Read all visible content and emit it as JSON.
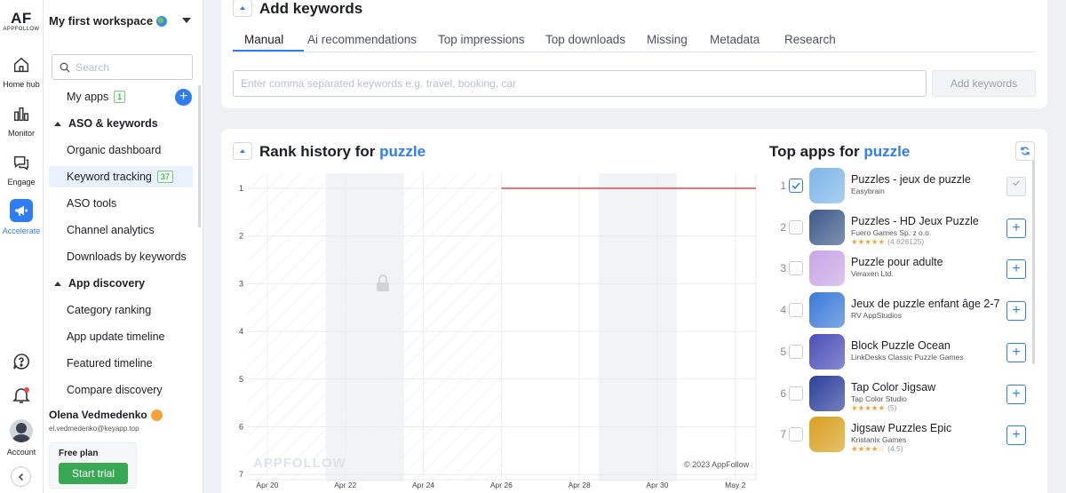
{
  "brand": {
    "logo_big": "AF",
    "logo_small": "APPFOLLOW"
  },
  "rail": {
    "home": "Home hub",
    "monitor": "Monitor",
    "engage": "Engage",
    "accelerate": "Accelerate",
    "account": "Account"
  },
  "sidebar": {
    "workspace": "My first workspace",
    "search_placeholder": "Search",
    "my_apps": {
      "label": "My apps",
      "badge": "1"
    },
    "aso_section": "ASO & keywords",
    "organic_dashboard": "Organic dashboard",
    "keyword_tracking": {
      "label": "Keyword tracking",
      "badge": "37"
    },
    "aso_tools": "ASO tools",
    "channel_analytics": "Channel analytics",
    "downloads_by_keywords": "Downloads by keywords",
    "discovery_section": "App discovery",
    "category_ranking": "Category ranking",
    "app_update_timeline": "App update timeline",
    "featured_timeline": "Featured timeline",
    "compare_discovery": "Compare discovery",
    "user_name": "Olena Vedmedenko",
    "user_email": "el.vedmedenko@keyapp.top",
    "plan_label": "Free plan",
    "start_trial": "Start trial"
  },
  "add_keywords": {
    "title": "Add keywords",
    "tabs": [
      "Manual",
      "Ai recommendations",
      "Top impressions",
      "Top downloads",
      "Missing",
      "Metadata",
      "Research"
    ],
    "input_placeholder": "Enter comma separated keywords e.g. travel, booking, car",
    "button": "Add keywords"
  },
  "rank_history": {
    "title_prefix": "Rank history for ",
    "keyword": "puzzle",
    "watermark": "APPFOLLOW",
    "copyright": "© 2023 AppFollow"
  },
  "chart_data": {
    "type": "line",
    "y_ticks": [
      "1",
      "2",
      "3",
      "4",
      "5",
      "6",
      "7"
    ],
    "x_ticks": [
      "Apr 20",
      "Apr 22",
      "Apr 24",
      "Apr 26",
      "Apr 28",
      "Apr 30",
      "May 2"
    ],
    "ylim": [
      1,
      7
    ],
    "y_inverted": true,
    "series": [
      {
        "x": [
          "Apr 26",
          "May 2"
        ],
        "y": [
          1,
          1
        ],
        "color": "#e8474c"
      }
    ],
    "locked_range": [
      "Apr 19",
      "Apr 26"
    ],
    "shaded_weekend_bands": [
      [
        "Apr 22",
        "Apr 24"
      ],
      [
        "Apr 29",
        "May 1"
      ]
    ]
  },
  "top_apps": {
    "title_prefix": "Top apps for ",
    "keyword": "puzzle",
    "apps": [
      {
        "rank": "1",
        "name": "Puzzles - jeux de puzzle",
        "dev": "Easybrain",
        "stars": "",
        "count": "",
        "checked": true,
        "color": "#7fb6e8"
      },
      {
        "rank": "2",
        "name": "Puzzles - HD Jeux Puzzle",
        "dev": "Fuero Games Sp. z o.o.",
        "stars": "★★★★★",
        "count": "(4.828125)",
        "checked": false,
        "color": "#3d5a8a"
      },
      {
        "rank": "3",
        "name": "Puzzle pour adulte",
        "dev": "Veraxen Ltd.",
        "stars": "",
        "count": "",
        "checked": false,
        "color": "#c9a6e6"
      },
      {
        "rank": "4",
        "name": "Jeux de puzzle enfant âge 2-7",
        "dev": "RV AppStudios",
        "stars": "",
        "count": "",
        "checked": false,
        "color": "#3b7ad8"
      },
      {
        "rank": "5",
        "name": "Block Puzzle Ocean",
        "dev": "LinkDesks Classic Puzzle Games",
        "stars": "",
        "count": "",
        "checked": false,
        "color": "#4a4fb8"
      },
      {
        "rank": "6",
        "name": "Tap Color Jigsaw",
        "dev": "Tap Color Studio",
        "stars": "★★★★★",
        "count": "(5)",
        "checked": false,
        "color": "#2c3f9c"
      },
      {
        "rank": "7",
        "name": "Jigsaw Puzzles Epic",
        "dev": "Kristanix Games",
        "stars": "★★★★☆",
        "count": "(4.5)",
        "checked": false,
        "color": "#d9a021"
      }
    ]
  }
}
